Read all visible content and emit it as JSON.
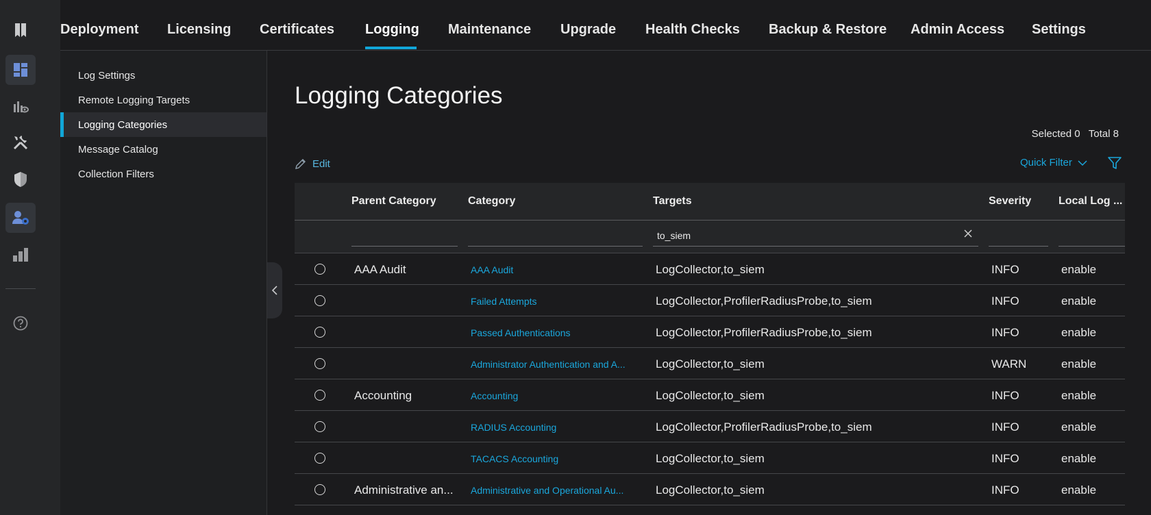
{
  "icons": {
    "rail": [
      "bookmark-icon",
      "dashboard-icon",
      "context-visibility-icon",
      "tools-icon",
      "shield-icon",
      "administration-icon",
      "work-centers-icon",
      "help-icon"
    ]
  },
  "colors": {
    "accent": "#11a6d8",
    "link": "#1aa7dc",
    "rail_bg": "#252628",
    "page_bg": "#1b1b1d"
  },
  "topnav": {
    "tabs": [
      {
        "label": "Deployment"
      },
      {
        "label": "Licensing"
      },
      {
        "label": "Certificates"
      },
      {
        "label": "Logging"
      },
      {
        "label": "Maintenance"
      },
      {
        "label": "Upgrade"
      },
      {
        "label": "Health Checks"
      },
      {
        "label": "Backup & Restore"
      },
      {
        "label": "Admin Access"
      },
      {
        "label": "Settings"
      }
    ],
    "active": "Logging"
  },
  "leftnav": {
    "items": [
      {
        "label": "Log Settings"
      },
      {
        "label": "Remote Logging Targets"
      },
      {
        "label": "Logging Categories"
      },
      {
        "label": "Message Catalog"
      },
      {
        "label": "Collection Filters"
      }
    ],
    "active": "Logging Categories"
  },
  "main": {
    "title": "Logging Categories",
    "selected_label": "Selected",
    "selected_count": "0",
    "total_label": "Total",
    "total_count": "8",
    "edit_label": "Edit",
    "quick_filter_label": "Quick Filter"
  },
  "table": {
    "columns": [
      "Parent Category",
      "Category",
      "Targets",
      "Severity",
      "Local Log ..."
    ],
    "filters": {
      "targets": "to_siem"
    },
    "rows": [
      {
        "parent": "AAA Audit",
        "category": "AAA Audit",
        "targets": "LogCollector,to_siem",
        "severity": "INFO",
        "local": "enable"
      },
      {
        "parent": "",
        "category": "Failed Attempts",
        "targets": "LogCollector,ProfilerRadiusProbe,to_siem",
        "severity": "INFO",
        "local": "enable"
      },
      {
        "parent": "",
        "category": "Passed Authentications",
        "targets": "LogCollector,ProfilerRadiusProbe,to_siem",
        "severity": "INFO",
        "local": "enable"
      },
      {
        "parent": "",
        "category": "Administrator Authentication and A...",
        "targets": "LogCollector,to_siem",
        "severity": "WARN",
        "local": "enable"
      },
      {
        "parent": "Accounting",
        "category": "Accounting",
        "targets": "LogCollector,to_siem",
        "severity": "INFO",
        "local": "enable"
      },
      {
        "parent": "",
        "category": "RADIUS Accounting",
        "targets": "LogCollector,ProfilerRadiusProbe,to_siem",
        "severity": "INFO",
        "local": "enable"
      },
      {
        "parent": "",
        "category": "TACACS Accounting",
        "targets": "LogCollector,to_siem",
        "severity": "INFO",
        "local": "enable"
      },
      {
        "parent": "Administrative an...",
        "category": "Administrative and Operational Au...",
        "targets": "LogCollector,to_siem",
        "severity": "INFO",
        "local": "enable"
      }
    ]
  }
}
